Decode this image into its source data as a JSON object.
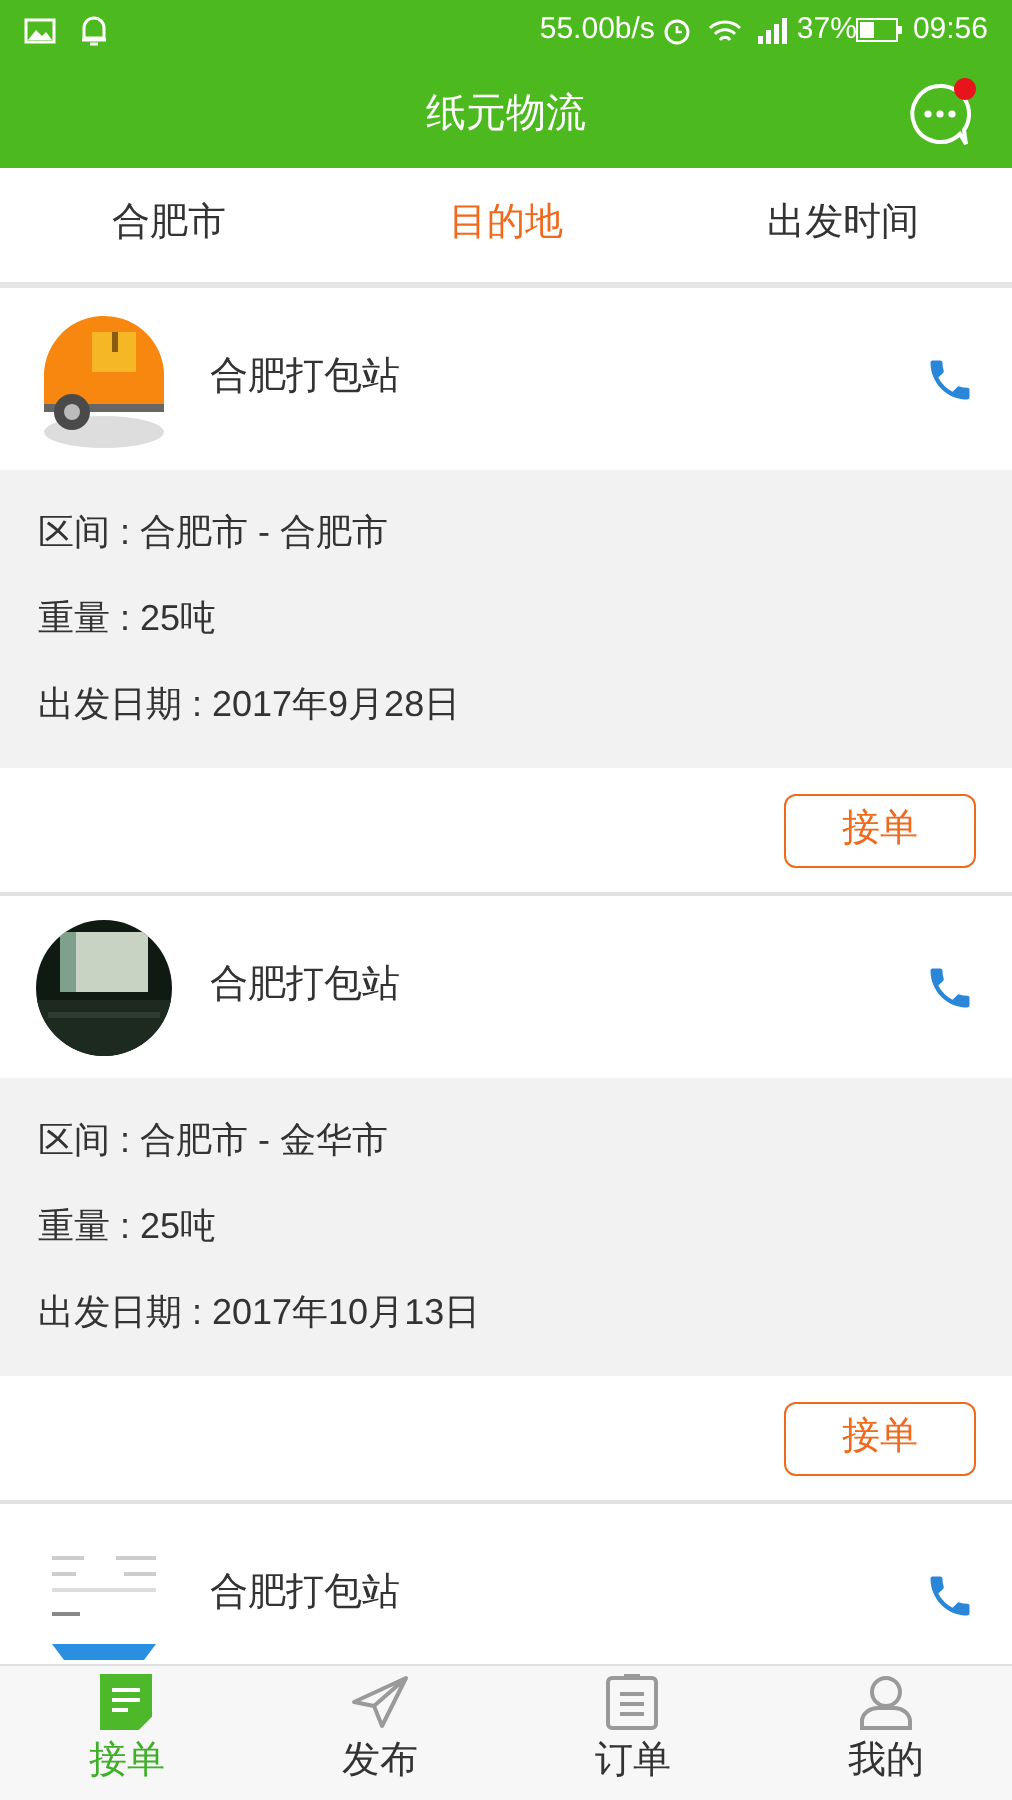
{
  "status_bar": {
    "speed": "55.00b/s",
    "battery": "37%",
    "time": "09:56"
  },
  "header": {
    "title": "纸元物流",
    "unread": true
  },
  "filters": [
    {
      "label": "合肥市",
      "selected": false
    },
    {
      "label": "目的地",
      "selected": true
    },
    {
      "label": "出发时间",
      "selected": false
    }
  ],
  "cards": [
    {
      "avatar": {
        "kind": "truck"
      },
      "name": "合肥打包站",
      "details": [
        "区间 : 合肥市 - 合肥市",
        "重量 : 25吨",
        "出发日期 : 2017年9月28日"
      ],
      "action": "接单"
    },
    {
      "avatar": {
        "kind": "picture"
      },
      "name": "合肥打包站",
      "details": [
        "区间 : 合肥市 - 金华市",
        "重量 : 25吨",
        "出发日期 : 2017年10月13日"
      ],
      "action": "接单"
    },
    {
      "avatar": {
        "kind": "document"
      },
      "name": "合肥打包站"
    }
  ],
  "nav": [
    {
      "label": "接单",
      "kind": "note",
      "selected": true
    },
    {
      "label": "发布",
      "kind": "send",
      "selected": false
    },
    {
      "label": "订单",
      "kind": "list",
      "selected": false
    },
    {
      "label": "我的",
      "kind": "user",
      "selected": false
    }
  ]
}
